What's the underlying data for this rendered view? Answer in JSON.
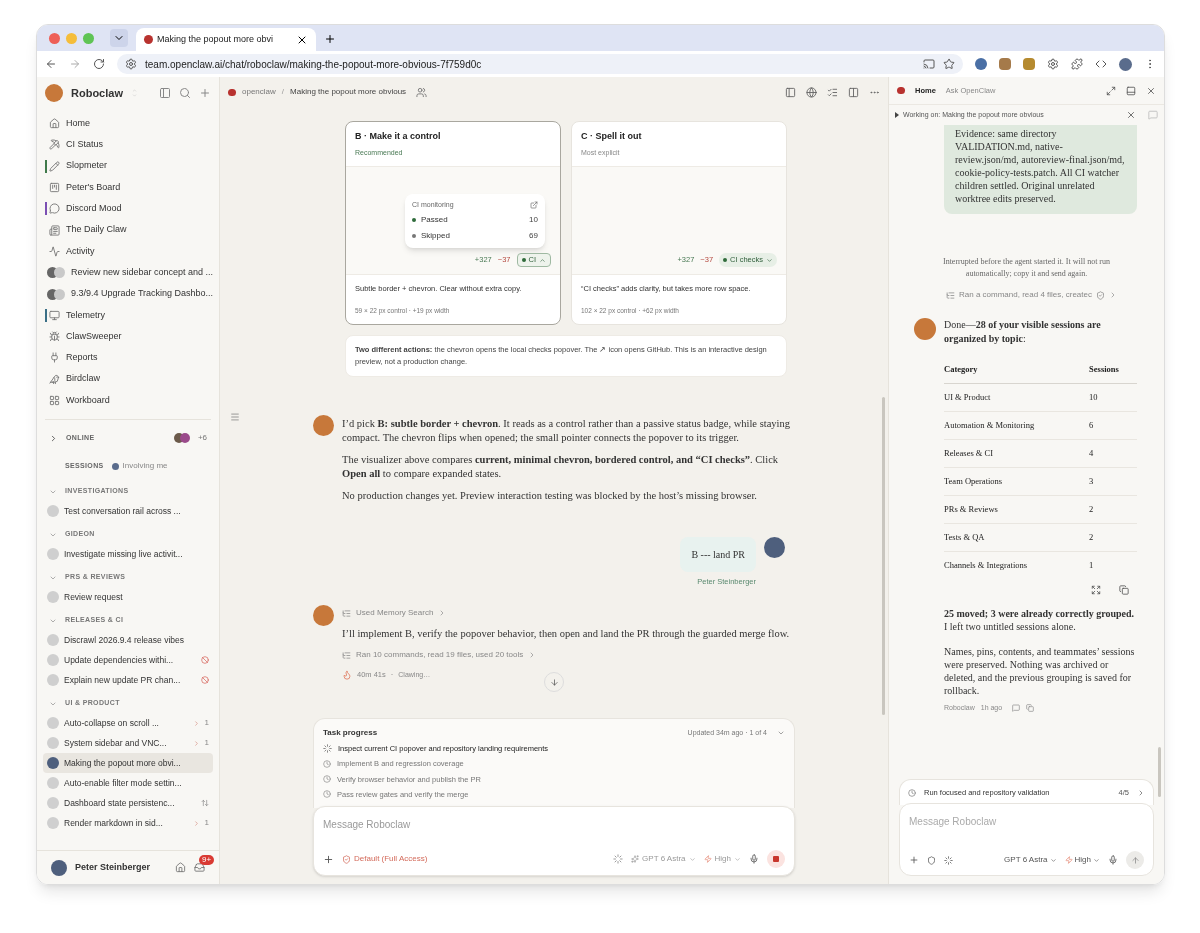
{
  "browser": {
    "tab_title": "Making the popout more obvi",
    "address": "team.openclaw.ai/chat/roboclaw/making-the-popout-more-obvious-7f759d0c"
  },
  "sidebar": {
    "workspace": "Roboclaw",
    "nav": [
      {
        "label": "Home",
        "kind": "page"
      },
      {
        "label": "CI Status",
        "kind": "page"
      },
      {
        "label": "Slopmeter",
        "kind": "page",
        "color": "#3f7a4a"
      },
      {
        "label": "Peter's Board",
        "kind": "page"
      },
      {
        "label": "Discord Mood",
        "kind": "page",
        "color": "#7b4fb3"
      },
      {
        "label": "The Daily Claw",
        "kind": "page"
      },
      {
        "label": "Activity",
        "kind": "page"
      },
      {
        "label": "Review new sidebar concept and ...",
        "kind": "thread"
      },
      {
        "label": "9.3/9.4 Upgrade Tracking Dashbo...",
        "kind": "thread"
      },
      {
        "label": "Telemetry",
        "kind": "page",
        "color": "#3a6f86"
      },
      {
        "label": "ClawSweeper",
        "kind": "page"
      },
      {
        "label": "Reports",
        "kind": "page"
      },
      {
        "label": "Birdclaw",
        "kind": "page"
      },
      {
        "label": "Workboard",
        "kind": "page"
      }
    ],
    "online": {
      "label": "ONLINE",
      "expanded": false,
      "more": "+6"
    },
    "sessions": {
      "label": "SESSIONS",
      "filter": "Involving me"
    },
    "groups": [
      {
        "label": "INVESTIGATIONS",
        "expanded": true,
        "items": [
          {
            "label": "Test conversation rail across ...",
            "selected": false,
            "kind": "plain"
          }
        ]
      },
      {
        "label": "GIDEON",
        "expanded": true,
        "items": [
          {
            "label": "Investigate missing live activit...",
            "selected": false,
            "kind": "plain"
          }
        ]
      },
      {
        "label": "PRS & REVIEWS",
        "expanded": true,
        "items": [
          {
            "label": "Review request",
            "selected": false,
            "kind": "plain"
          }
        ]
      },
      {
        "label": "RELEASES & CI",
        "expanded": true,
        "items": [
          {
            "label": "Discrawl 2026.9.4 release vibes",
            "selected": false,
            "kind": "plain"
          },
          {
            "label": "Update dependencies withi...",
            "selected": false,
            "kind": "alert"
          },
          {
            "label": "Explain new update PR chan...",
            "selected": false,
            "kind": "alert"
          }
        ]
      },
      {
        "label": "UI & PRODUCT",
        "expanded": true,
        "items": [
          {
            "label": "Auto-collapse on scroll ...",
            "selected": false,
            "kind": "count",
            "count": "1"
          },
          {
            "label": "System sidebar and VNC...",
            "selected": false,
            "kind": "count",
            "count": "1"
          },
          {
            "label": "Making the popout more obvi...",
            "selected": true,
            "kind": "plain"
          },
          {
            "label": "Auto-enable filter mode settin...",
            "selected": false,
            "kind": "plain"
          },
          {
            "label": "Dashboard state persistenc...",
            "selected": false,
            "kind": "sync"
          },
          {
            "label": "Render markdown in sid...",
            "selected": false,
            "kind": "count",
            "count": "1"
          }
        ]
      }
    ],
    "user": {
      "name": "Peter Steinberger",
      "badge": "9+"
    }
  },
  "main": {
    "breadcrumb": {
      "project": "openclaw",
      "separator": "/",
      "title": "Making the popout more obvious"
    },
    "cards": [
      {
        "title": "B · Make it a control",
        "subtitle": "Recommended",
        "selected": true,
        "popover": {
          "title": "CI monitoring",
          "rows": [
            {
              "label": "Passed",
              "value": "10",
              "color": "#2f6b3a"
            },
            {
              "label": "Skipped",
              "value": "69",
              "color": "#777777"
            }
          ]
        },
        "added": "+327",
        "removed": "−37",
        "chip": "CI",
        "expanded": true,
        "description": "Subtle border + chevron. Clear without extra copy.",
        "meta": "59 × 22 px control · +19 px width"
      },
      {
        "title": "C · Spell it out",
        "subtitle": "Most explicit",
        "selected": false,
        "added": "+327",
        "removed": "−37",
        "chip": "CI checks",
        "expanded": false,
        "description": "“CI checks” adds clarity, but takes more row space.",
        "meta": "102 × 22 px control · +62 px width"
      }
    ],
    "note": "**Two different actions:** the chevron opens the local checks popover. The ↗ icon opens GitHub. This is an interactive design preview, not a production change.",
    "messages": [
      {
        "kind": "assistant",
        "paragraphs": [
          "I’d pick **B: subtle border + chevron**. It reads as a control rather than a passive status badge, while staying compact. The chevron flips when opened; the small pointer connects the popover to its trigger.",
          "The visualizer above compares **current, minimal chevron, bordered control, and “CI checks”**. Click **Open all** to compare expanded states.",
          "No production changes yet. Preview interaction testing was blocked by the host’s missing browser."
        ]
      },
      {
        "kind": "user",
        "text": "B --- land PR",
        "author": "Peter Steinberger"
      },
      {
        "kind": "assistant",
        "tool": "Used Memory Search",
        "paragraphs": [
          "I’ll implement B, verify the popover behavior, then open and land the PR through the guarded merge flow."
        ],
        "summary": "Ran 10 commands, read 19 files, used 20 tools",
        "elapsed": "40m 41s",
        "separator": "·",
        "status": "Clawing…"
      }
    ],
    "task_progress": {
      "title": "Task progress",
      "updated": "Updated 34m ago · 1 of 4",
      "steps": [
        {
          "label": "Inspect current CI popover and repository landing requirements",
          "running": true
        },
        {
          "label": "Implement B and regression coverage",
          "running": false
        },
        {
          "label": "Verify browser behavior and publish the PR",
          "running": false
        },
        {
          "label": "Pass review gates and verify the merge",
          "running": false
        }
      ]
    },
    "composer": {
      "placeholder": "Message Roboclaw",
      "mode": "Default (Full Access)",
      "model": "GPT 6 Astra",
      "effort": "High"
    }
  },
  "panel": {
    "tabs": [
      {
        "label": "Home",
        "selected": true
      },
      {
        "label": "Ask OpenClaw",
        "selected": false
      }
    ],
    "working_on": "Working on: Making the popout more obvious",
    "bubble": "Evidence: same directory VALIDATION.md, native-review.json/md, autoreview-final.json/md, cookie-policy-tests.patch. All CI watcher children settled. Original unrelated worktree edits preserved.",
    "interrupted": "Interrupted before the agent started it. It will not run automatically; copy it and send again.",
    "tool_summary": "Ran a command, read 4 files, createc",
    "intro": "Done—**28 of your visible sessions are organized by topic**:",
    "table": {
      "columns": [
        "Category",
        "Sessions"
      ],
      "rows": [
        [
          "UI & Product",
          "10"
        ],
        [
          "Automation & Monitoring",
          "6"
        ],
        [
          "Releases & CI",
          "4"
        ],
        [
          "Team Operations",
          "3"
        ],
        [
          "PRs & Reviews",
          "2"
        ],
        [
          "Tests & QA",
          "2"
        ],
        [
          "Channels & Integrations",
          "1"
        ]
      ]
    },
    "paragraphs": [
      "**25 moved; 3 were already correctly grouped.** I left two untitled sessions alone.",
      "Names, pins, contents, and teammates’ sessions were preserved. Nothing was archived or deleted, and the previous grouping is saved for rollback."
    ],
    "author": "Roboclaw",
    "time": "1h ago",
    "task": {
      "label": "Run focused and repository validation",
      "count": "4/5"
    },
    "composer": {
      "placeholder": "Message Roboclaw",
      "model": "GPT 6 Astra",
      "effort": "High"
    }
  }
}
